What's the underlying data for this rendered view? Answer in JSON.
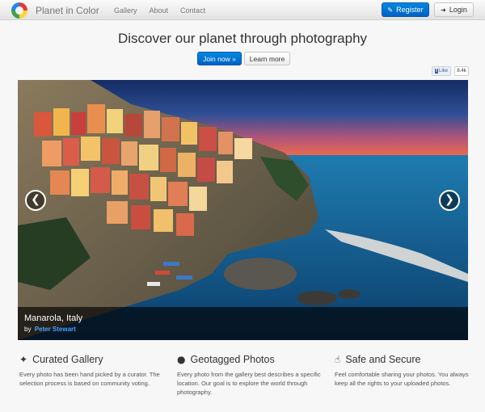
{
  "navbar": {
    "brand": "Planet in Color",
    "links": [
      "Gallery",
      "About",
      "Contact"
    ],
    "register_label": "Register",
    "login_label": "Login"
  },
  "hero": {
    "title": "Discover our planet through photography",
    "join_label": "Join now »",
    "learn_label": "Learn more"
  },
  "facebook": {
    "like_label": "Like",
    "count": "8.4k"
  },
  "carousel": {
    "caption_title": "Manarola, Italy",
    "caption_by": "by",
    "caption_author": "Peter Stewart",
    "prev_glyph": "❮",
    "next_glyph": "❯"
  },
  "features": [
    {
      "icon": "magic-wand-icon",
      "title": "Curated Gallery",
      "text": "Every photo has been hand picked by a curator. The selection process is based on community voting."
    },
    {
      "icon": "globe-icon",
      "title": "Geotagged Photos",
      "text": "Every photo from the gallery best describes a specific location. Our goal is to explore the world through photography."
    },
    {
      "icon": "thumbs-up-icon",
      "title": "Safe and Secure",
      "text": "Feel comfortable sharing your photos. You always keep all the rights to your uploaded photos."
    }
  ],
  "colors": {
    "primary": "#0070d2",
    "link": "#4aa3ff"
  }
}
